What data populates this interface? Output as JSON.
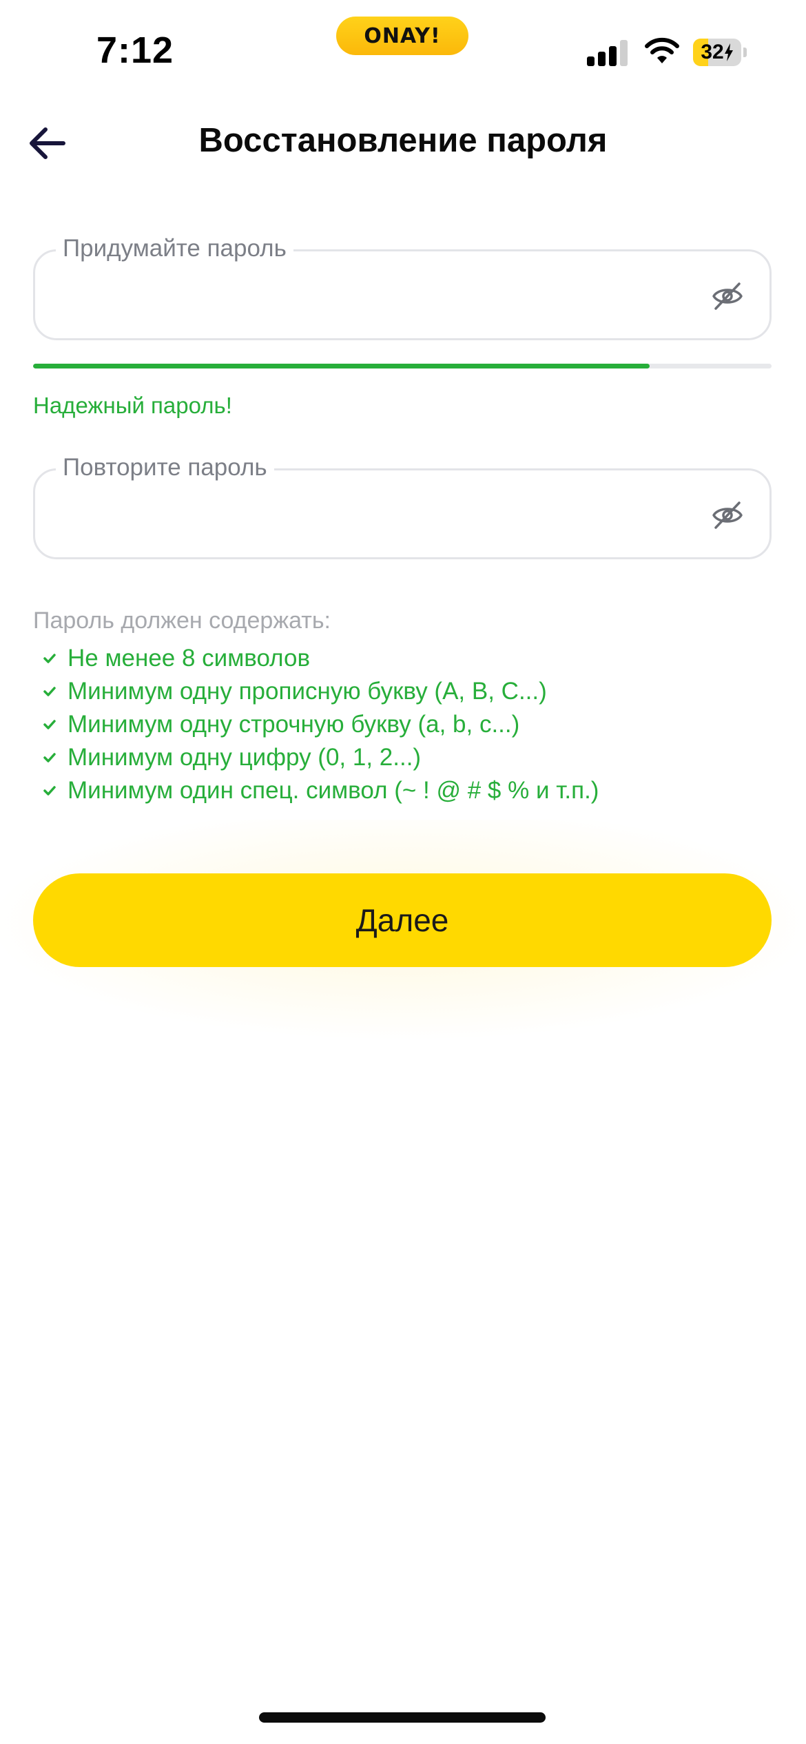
{
  "status_bar": {
    "time": "7:12",
    "island_label": "ONAY!",
    "battery_level": "32",
    "battery_fraction": 0.32,
    "signal_bars_active": 3,
    "signal_bars_total": 4,
    "icons": [
      "signal-icon",
      "wifi-icon",
      "battery-icon",
      "charging-bolt-icon"
    ]
  },
  "header": {
    "back_icon": "arrow-left-icon",
    "title": "Восстановление пароля"
  },
  "new_password": {
    "label": "Придумайте пароль",
    "value": "",
    "toggle_icon": "eye-off-icon"
  },
  "strength": {
    "level": 0.835,
    "text": "Надежный пароль!",
    "color": "#27AE3A"
  },
  "repeat_password": {
    "label": "Повторите пароль",
    "value": "",
    "toggle_icon": "eye-off-icon"
  },
  "requirements": {
    "title": "Пароль должен содержать:",
    "check_icon": "checkmark-icon",
    "items": [
      {
        "text": "Не менее 8 символов",
        "met": true
      },
      {
        "text": "Минимум одну прописную букву (A, B, C...)",
        "met": true
      },
      {
        "text": "Минимум одну строчную букву (a, b, c...)",
        "met": true
      },
      {
        "text": "Минимум одну цифру (0, 1, 2...)",
        "met": true
      },
      {
        "text": "Минимум один спец. символ (~ ! @ # $ % и т.п.)",
        "met": true
      }
    ]
  },
  "next_button": {
    "label": "Далее",
    "color": "#FFD900"
  }
}
